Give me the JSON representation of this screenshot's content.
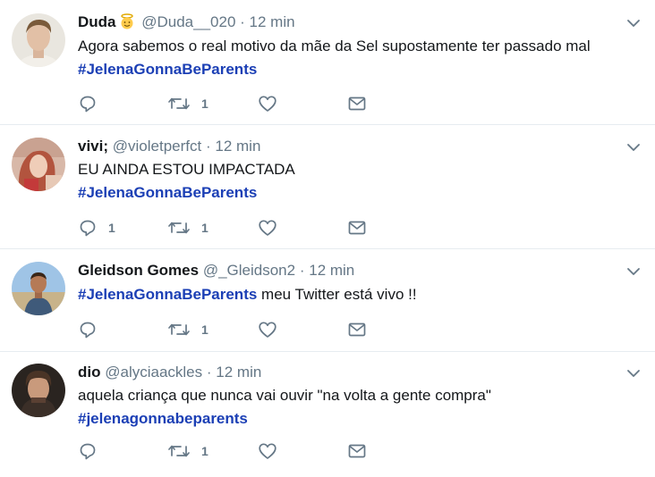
{
  "tweets": [
    {
      "fullname": "Duda",
      "screen_name": "@Duda__020",
      "separator": "·",
      "time": "12 min",
      "text": "Agora sabemos o real motivo da mãe da Sel supostamente ter passado mal",
      "hashtag": "#JelenaGonnaBeParents",
      "after_hashtag": "",
      "reply_count": "",
      "retweet_count": "1",
      "has_emoji": true,
      "emoji_icon": "angel-icon"
    },
    {
      "fullname": "vivi;",
      "screen_name": "@violetperfct",
      "separator": "·",
      "time": "12 min",
      "text": "EU AINDA ESTOU IMPACTADA",
      "hashtag": "#JelenaGonnaBeParents",
      "after_hashtag": "",
      "reply_count": "1",
      "retweet_count": "1"
    },
    {
      "fullname": "Gleidson Gomes",
      "screen_name": "@_Gleidson2",
      "separator": "·",
      "time": "12 min",
      "text": "",
      "hashtag": "#JelenaGonnaBeParents",
      "after_hashtag": " meu Twitter está vivo !!",
      "reply_count": "",
      "retweet_count": "1"
    },
    {
      "fullname": "dio",
      "screen_name": "@alyciaackles",
      "separator": "·",
      "time": "12 min",
      "text": "aquela criança que nunca vai ouvir \"na volta a gente compra\"",
      "hashtag": "#jelenagonnabeparents",
      "after_hashtag": "",
      "reply_count": "",
      "retweet_count": "1"
    }
  ],
  "colors": {
    "hashtag": "#1b3fb5",
    "muted": "#657786",
    "divider": "#e6ecf0"
  },
  "icons": [
    "reply-icon",
    "retweet-icon",
    "like-icon",
    "direct-message-icon",
    "chevron-down-icon"
  ]
}
